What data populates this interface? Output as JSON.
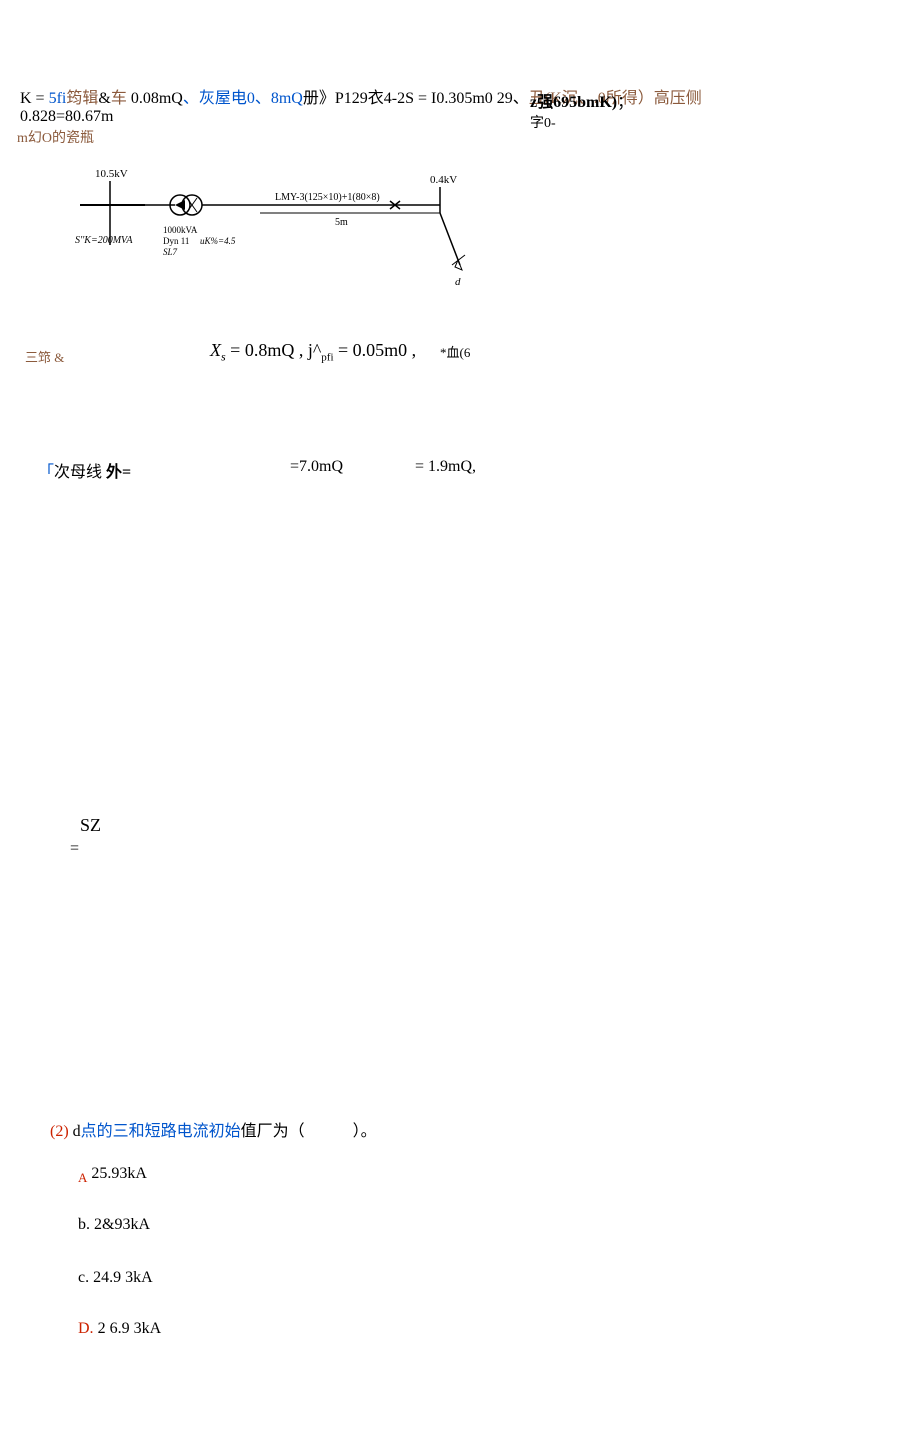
{
  "header": {
    "line1_p1": "K =",
    "line1_p2": " 5fi",
    "line1_p3": "筠辑",
    "line1_p4": "&",
    "line1_p5": "车",
    "line1_p6": " 0.08mQ",
    "line1_p7": "、灰屋电0、8mQ",
    "line1_p8": "册》P129衣4-2S",
    "line1_p9": " = I0.305m0 29、",
    "line1_p10": "丑(K沉",
    "line1_p11": "、.0所得）高压侧",
    "line2": "0.828=80.67m",
    "line3": "m",
    "line3_b": "幻O的瓷瓶",
    "right1_a": "z强695bmK)",
    "right1_b": "；",
    "right2": "字0-"
  },
  "diagram": {
    "voltage_left": "10.5kV",
    "voltage_right": "0.4kV",
    "cable": "LMY-3(125×10)+1(80×8)",
    "length": "5m",
    "sk": "S''K=200MVA",
    "transformer_kva": "1000kVA",
    "transformer_type": "Dyn 11",
    "uk": "uK%=4.5",
    "sl": "SL7",
    "point": "d"
  },
  "line1": {
    "left": "三筇 &",
    "mid_xs": "X",
    "mid_s": "s",
    "mid_eq": " = 0.8mQ , j^",
    "mid_pfi": "pfi",
    "mid_eq2": " = 0.05m0 ,",
    "right": "*血(6"
  },
  "line2": {
    "left_bracket": "「",
    "left_text": "次母线 ",
    "left_wai": "外=",
    "mid": "=7.0mQ",
    "right": "= 1.9mQ,"
  },
  "sz": {
    "text": "SZ",
    "eq": "="
  },
  "question2": {
    "num": "(2)",
    "text_d": "  d",
    "text_mid": "点的三和短路电流初始",
    "text_val": "值厂为（　　　）。"
  },
  "options": {
    "a_label": "A",
    "a_value": " 25.93kA",
    "b_label": "b.",
    "b_value": "  2&93kA",
    "c_label": "c.",
    "c_value": "  24.9 3kA",
    "d_label": "D.",
    "d_value": " 2 6.9 3kA"
  }
}
